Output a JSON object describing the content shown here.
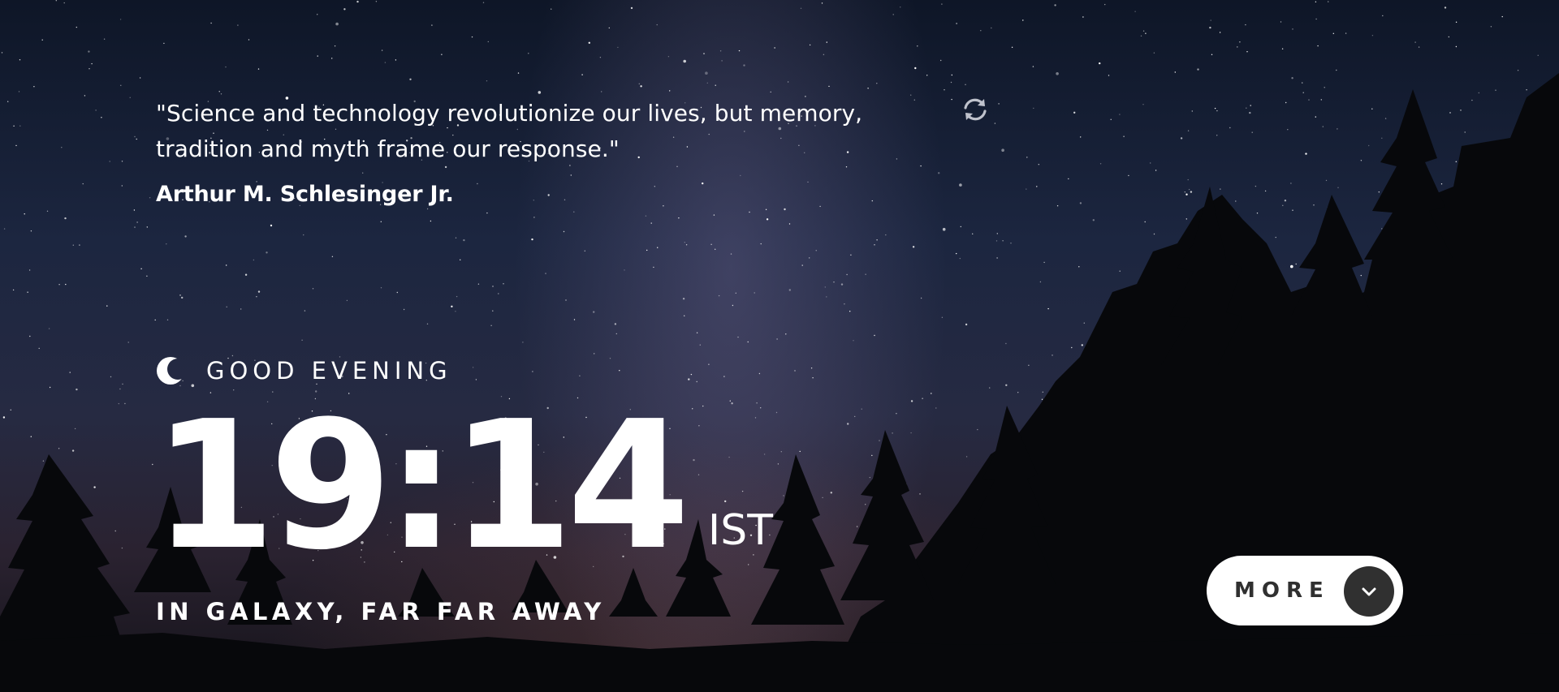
{
  "quote": {
    "text": "\"Science and technology revolutionize our lives, but memory, tradition and myth frame our response.\"",
    "author": "Arthur M. Schlesinger Jr.",
    "refresh_icon": "refresh-icon"
  },
  "greeting": {
    "icon": "moon-icon",
    "label": "GOOD EVENING"
  },
  "clock": {
    "time": "19:14",
    "timezone": "IST",
    "location": "IN GALAXY, FAR FAR AWAY"
  },
  "more_button": {
    "label": "MORE",
    "icon": "chevron-down-icon"
  },
  "colors": {
    "text": "#ffffff",
    "button_background": "#ffffff",
    "button_text": "#303030",
    "chevron_background": "#303030"
  }
}
